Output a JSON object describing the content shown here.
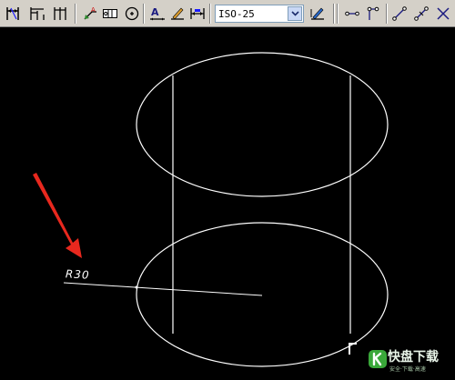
{
  "toolbar": {
    "buttons": [
      {
        "icon": "dim-linear-icon"
      },
      {
        "icon": "dim-baseline-icon"
      },
      {
        "icon": "dim-continue-icon"
      },
      {
        "icon": "qleader-icon"
      },
      {
        "icon": "tolerance-icon"
      },
      {
        "icon": "center-mark-icon"
      },
      {
        "icon": "dim-edit-icon"
      },
      {
        "icon": "dim-text-edit-icon"
      },
      {
        "icon": "dim-update-icon"
      },
      {
        "icon": "dim-style-manager-icon"
      },
      {
        "icon": "snap-endpoint-icon"
      },
      {
        "icon": "snap-midpoint-icon"
      },
      {
        "icon": "snap-parallel-icon"
      },
      {
        "icon": "snap-perpendicular-icon"
      },
      {
        "icon": "snap-intersection-icon"
      }
    ],
    "dim_style": {
      "selected": "ISO-25"
    }
  },
  "drawing": {
    "radius_label": "R30",
    "line_color": "#ffffff",
    "annotation_arrow_color": "#e8281e"
  },
  "watermark": {
    "brand": "快盘下载",
    "tagline": "安全·下载·高速"
  }
}
